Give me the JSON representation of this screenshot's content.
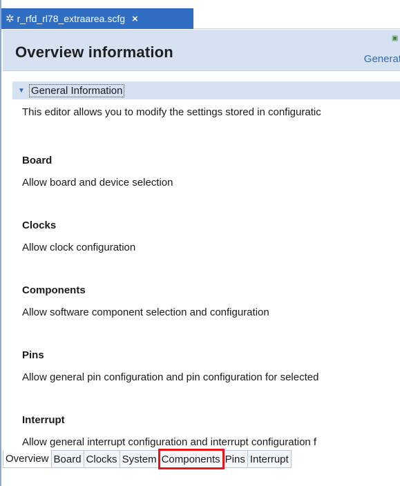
{
  "editor_tab": {
    "title": "r_rfd_rl78_extraarea.scfg",
    "icon": "gear-icon",
    "close": "×"
  },
  "header": {
    "title": "Overview information",
    "generate_link": "Generat"
  },
  "section": {
    "title": "General Information"
  },
  "intro": "This editor allows you to modify the settings stored in configuratic",
  "items": [
    {
      "heading": "Board",
      "desc": "Allow board and device selection"
    },
    {
      "heading": "Clocks",
      "desc": "Allow clock configuration"
    },
    {
      "heading": "Components",
      "desc": "Allow software component selection and configuration"
    },
    {
      "heading": "Pins",
      "desc": "Allow general pin configuration and pin configuration for selected"
    },
    {
      "heading": "Interrupt",
      "desc": "Allow general interrupt configuration and interrupt configuration f"
    }
  ],
  "bottom_tabs": [
    {
      "label": "Overview",
      "active": true
    },
    {
      "label": "Board"
    },
    {
      "label": "Clocks"
    },
    {
      "label": "System"
    },
    {
      "label": "Components",
      "highlighted": true
    },
    {
      "label": "Pins"
    },
    {
      "label": "Interrupt"
    }
  ],
  "colors": {
    "tab_blue": "#2f6ec3",
    "header_bg": "#d6e2f2",
    "link": "#2d6bb5",
    "highlight": "#e8141b"
  }
}
